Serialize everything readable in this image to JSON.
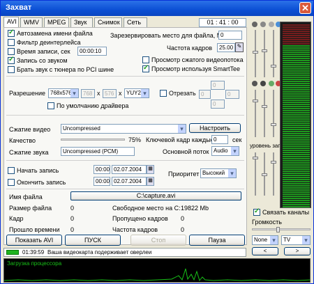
{
  "window": {
    "title": "Захват",
    "close": "✕"
  },
  "tabs": [
    "AVI",
    "WMV",
    "MPEG",
    "Звук",
    "Снимок",
    "Сеть"
  ],
  "clock": "01 : 41 : 00",
  "options": {
    "auto_rename": "Автозамена имени файла",
    "deinterlace": "Фильтр деинтерлейса",
    "record_time": "Время записи, сек",
    "record_time_value": "00:00:10",
    "with_sound": "Запись со звуком",
    "tuner_sound": "Брать звук с тюнера по PCI шине",
    "reserve_space": "Зарезервировать место для файла, Mb",
    "reserve_value": "0",
    "frame_rate": "Частота кадров",
    "frame_rate_value": "25.00",
    "compressed_preview": "Просмотр сжатого видеопотока",
    "smarttee_preview": "Просмотр используя SmartTee"
  },
  "resolution": {
    "label": "Разрешение",
    "value": "768x576",
    "w": "768",
    "x1": "x",
    "h": "576",
    "x2": "x",
    "format": "YUY2",
    "driver_default": "По умолчанию драйвера",
    "crop": "Отрезать",
    "crop_values": [
      "0",
      "0",
      "0",
      "0"
    ]
  },
  "compression": {
    "video_label": "Сжатие видео",
    "video_value": "Uncompressed",
    "configure": "Настроить",
    "quality_label": "Качество",
    "quality_value": "75%",
    "keyframe_label": "Ключевой кадр каждые",
    "keyframe_value": "0",
    "keyframe_unit": "сек",
    "audio_label": "Сжатие звука",
    "audio_value": "Uncompressed (PCM)",
    "main_stream_label": "Основной поток",
    "main_stream_value": "Audio"
  },
  "schedule": {
    "start": "Начать запись",
    "start_time": "00:00",
    "start_date": "02.07.2004",
    "end": "Окончить запись",
    "end_time": "00:00",
    "end_date": "02.07.2004",
    "priority_label": "Приоритет",
    "priority_value": "Высокий"
  },
  "info": {
    "filename_label": "Имя файла",
    "filename_value": "C:\\capture.avi",
    "filesize_label": "Размер файла",
    "filesize_value": "0",
    "free_label": "Свободное место на С:",
    "free_value": "19822 Mb",
    "frame_label": "Кадр",
    "frame_value": "0",
    "dropped_label": "Пропущено кадров",
    "dropped_value": "0",
    "elapsed_label": "Прошло времени",
    "elapsed_value": "0",
    "fps_label": "Частота кадров",
    "fps_value": "0"
  },
  "buttons": {
    "show_avi": "Показать AVI",
    "start": "ПУСК",
    "stop": "Стоп",
    "pause": "Пауза"
  },
  "status": {
    "time": "01:39:59",
    "message": "Ваша видеокарта подерживает оверлеи"
  },
  "right": {
    "record_level": "уровень записи",
    "link_channels": "Связать каналы",
    "volume": "Громкость",
    "source1": "None",
    "source2": "TV"
  },
  "cpu_label": "Загрузка процессора",
  "colors": {
    "accent": "#0b4fd4",
    "vu_green": "#1fb31f",
    "vu_red": "#c02020",
    "graph": "#18c018"
  }
}
